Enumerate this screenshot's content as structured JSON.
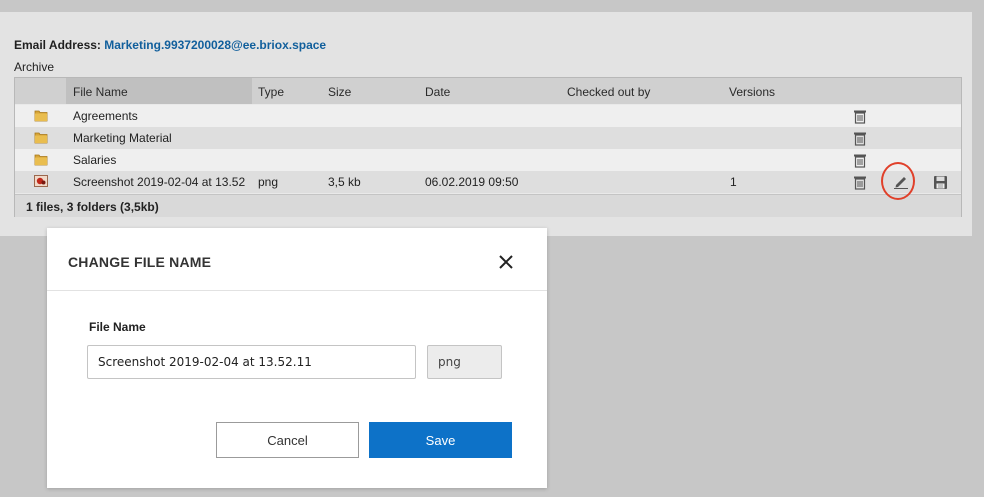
{
  "header": {
    "email_label": "Email Address:",
    "email_value": "Marketing.9937200028@ee.briox.space",
    "folder": "Archive"
  },
  "table": {
    "columns": [
      "File Name",
      "Type",
      "Size",
      "Date",
      "Checked out by",
      "Versions"
    ],
    "rows": [
      {
        "icon": "folder-icon",
        "name": "Agreements",
        "type": "",
        "size": "",
        "date": "",
        "checked_out_by": "",
        "versions": ""
      },
      {
        "icon": "folder-icon",
        "name": "Marketing Material",
        "type": "",
        "size": "",
        "date": "",
        "checked_out_by": "",
        "versions": ""
      },
      {
        "icon": "folder-icon",
        "name": "Salaries",
        "type": "",
        "size": "",
        "date": "",
        "checked_out_by": "",
        "versions": ""
      },
      {
        "icon": "image-file-icon",
        "name": "Screenshot 2019-02-04 at 13.52",
        "type": "png",
        "size": "3,5 kb",
        "date": "06.02.2019 09:50",
        "checked_out_by": "",
        "versions": "1"
      }
    ],
    "summary": "1 files, 3 folders (3,5kb)"
  },
  "modal": {
    "title": "CHANGE FILE NAME",
    "field_label": "File Name",
    "file_name_value": "Screenshot 2019-02-04 at 13.52.11",
    "extension": "png",
    "cancel_label": "Cancel",
    "save_label": "Save"
  },
  "colors": {
    "overlay": "#c7c7c7",
    "link": "#115f9c",
    "primary_button": "#0d72c8",
    "highlight": "#e0402a"
  }
}
